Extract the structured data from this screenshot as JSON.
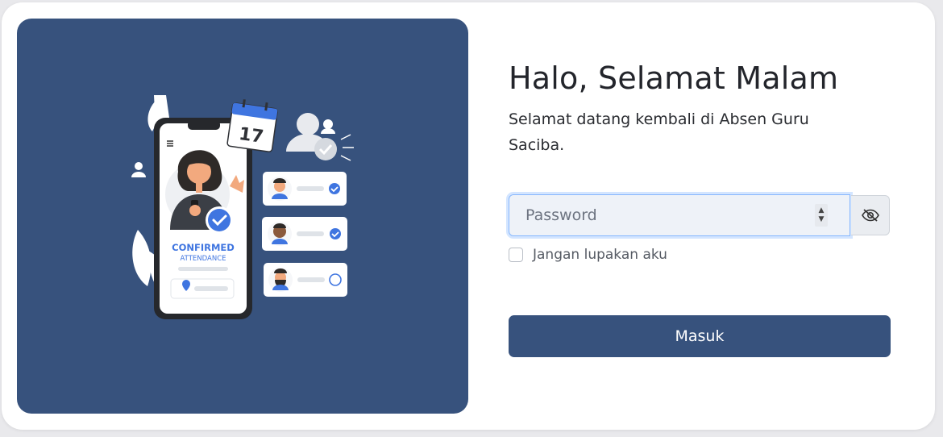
{
  "greeting": "Halo, Selamat Malam",
  "subtitle": "Selamat datang kembali di Absen Guru Saciba.",
  "password": {
    "value": "",
    "placeholder": "Password",
    "toggle_icon": "eye-slash-icon"
  },
  "remember": {
    "label": "Jangan lupakan aku",
    "checked": false
  },
  "submit_label": "Masuk",
  "illustration": {
    "calendar_day": "17",
    "badge_title": "CONFIRMED",
    "badge_sub": "ATTENDANCE"
  },
  "colors": {
    "brand": "#37527d",
    "accent": "#3f75e0",
    "background": "#ffffff"
  }
}
